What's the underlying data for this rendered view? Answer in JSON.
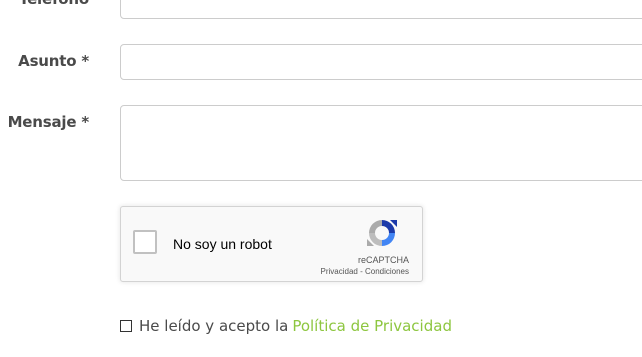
{
  "form": {
    "telefono_label": "Teléfono",
    "asunto_label": "Asunto *",
    "mensaje_label": "Mensaje *",
    "telefono_value": "",
    "asunto_value": "",
    "mensaje_value": ""
  },
  "recaptcha": {
    "label": "No soy un robot",
    "brand": "reCAPTCHA",
    "links": "Privacidad - Condiciones",
    "checked": false
  },
  "consent": {
    "text": "He leído y acepto la",
    "link_label": "Política de Privacidad",
    "checked": false,
    "link_color": "#8dc63f"
  }
}
